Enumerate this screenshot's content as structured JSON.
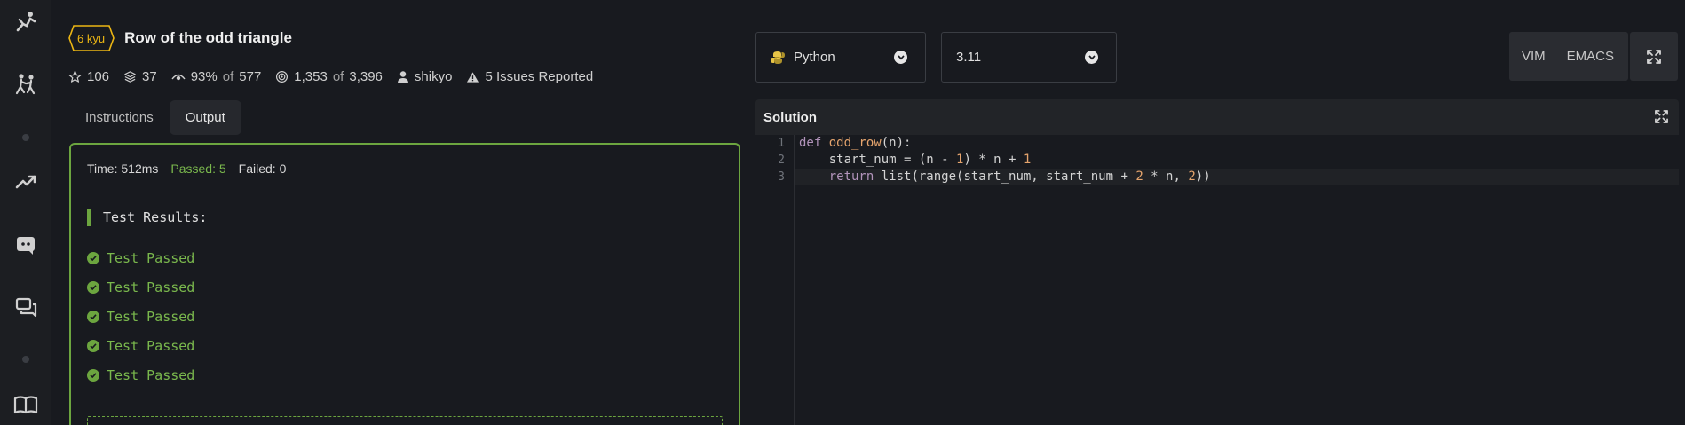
{
  "rail": {
    "icons": [
      "kata-runner-icon",
      "martial-arts-icon",
      "trending-icon",
      "discord-icon",
      "chat-icon",
      "book-icon"
    ]
  },
  "kata": {
    "rank": "6 kyu",
    "title": "Row of the odd triangle",
    "stats": {
      "stars": "106",
      "collections": "37",
      "satisfaction": "93%",
      "satisfaction_of": "of",
      "votes": "577",
      "completed": "1,353",
      "completed_of": "of",
      "attempted": "3,396",
      "author": "shikyo",
      "issues": "5 Issues Reported"
    }
  },
  "tabs": [
    {
      "label": "Instructions",
      "active": false
    },
    {
      "label": "Output",
      "active": true
    }
  ],
  "output": {
    "time": "Time: 512ms",
    "passed": "Passed: 5",
    "failed": "Failed: 0",
    "results_title": "Test Results:",
    "results": [
      "Test Passed",
      "Test Passed",
      "Test Passed",
      "Test Passed",
      "Test Passed"
    ]
  },
  "toolbar": {
    "language": "Python",
    "version": "3.11",
    "mode_vim": "VIM",
    "mode_emacs": "EMACS"
  },
  "editor": {
    "title": "Solution",
    "line_numbers": [
      "1",
      "2",
      "3"
    ],
    "lines": [
      "def odd_row(n):",
      "    start_num = (n - 1) * n + 1",
      "    return list(range(start_num, start_num + 2 * n, 2))"
    ]
  },
  "colors": {
    "accent_green": "#6ca53f",
    "kyu_yellow": "#ecb613",
    "background": "#181a1f"
  }
}
